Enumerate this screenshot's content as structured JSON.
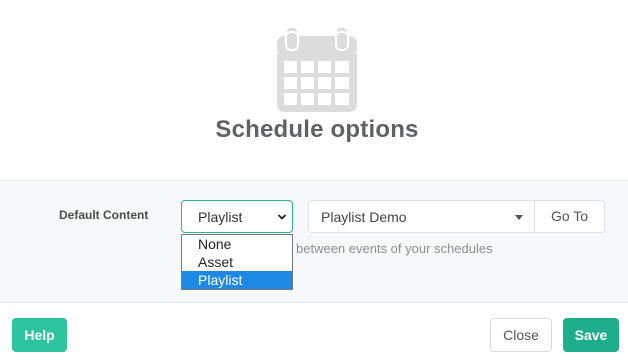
{
  "header": {
    "icon": "calendar-icon",
    "title": "Schedule options"
  },
  "form": {
    "default_content_label": "Default Content",
    "content_type": {
      "selected": "Playlist",
      "options": [
        "None",
        "Asset",
        "Playlist"
      ]
    },
    "content_item": {
      "selected": "Playlist Demo"
    },
    "goto_label": "Go To",
    "hint_text": "between events of your schedules"
  },
  "footer": {
    "help_label": "Help",
    "close_label": "Close",
    "save_label": "Save"
  },
  "colors": {
    "accent": "#2ec4a0",
    "save": "#1fae8b",
    "focus_border": "#2bb595",
    "option_highlight": "#1e88e5",
    "icon_gray": "#dcdcdc"
  }
}
